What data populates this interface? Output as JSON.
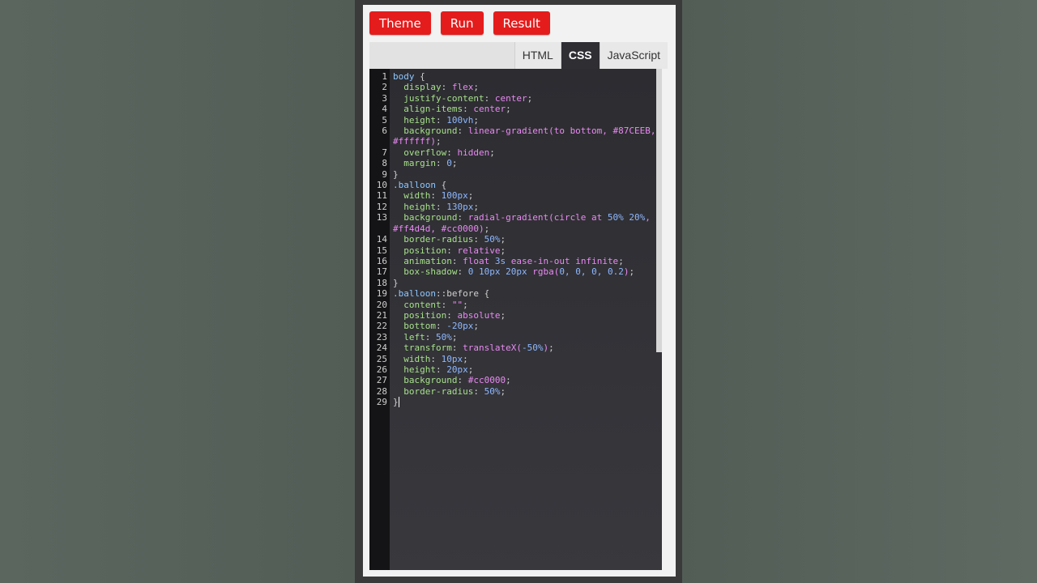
{
  "toolbar": {
    "buttons": [
      {
        "label": "Theme"
      },
      {
        "label": "Run"
      },
      {
        "label": "Result"
      }
    ],
    "color": "#e51c1c"
  },
  "tabs": [
    {
      "label": "HTML",
      "active": false
    },
    {
      "label": "CSS",
      "active": true
    },
    {
      "label": "JavaScript",
      "active": false
    }
  ],
  "editor": {
    "language": "css",
    "lines": [
      [
        [
          "sel",
          "body"
        ],
        [
          "punc",
          " {"
        ]
      ],
      [
        [
          "prop",
          "  display"
        ],
        [
          "punc",
          ": "
        ],
        [
          "kw",
          "flex"
        ],
        [
          "punc",
          ";"
        ]
      ],
      [
        [
          "prop",
          "  justify-content"
        ],
        [
          "punc",
          ": "
        ],
        [
          "kw",
          "center"
        ],
        [
          "punc",
          ";"
        ]
      ],
      [
        [
          "prop",
          "  align-items"
        ],
        [
          "punc",
          ": "
        ],
        [
          "kw",
          "center"
        ],
        [
          "punc",
          ";"
        ]
      ],
      [
        [
          "prop",
          "  height"
        ],
        [
          "punc",
          ": "
        ],
        [
          "num",
          "100vh"
        ],
        [
          "punc",
          ";"
        ]
      ],
      [
        [
          "prop",
          "  background"
        ],
        [
          "punc",
          ": "
        ],
        [
          "kw",
          "linear-gradient(to bottom, #87CEEB, #ffffff)"
        ],
        [
          "punc",
          ";"
        ]
      ],
      [
        [
          "prop",
          "  overflow"
        ],
        [
          "punc",
          ": "
        ],
        [
          "kw",
          "hidden"
        ],
        [
          "punc",
          ";"
        ]
      ],
      [
        [
          "prop",
          "  margin"
        ],
        [
          "punc",
          ": "
        ],
        [
          "num",
          "0"
        ],
        [
          "punc",
          ";"
        ]
      ],
      [
        [
          "punc",
          "}"
        ]
      ],
      [
        [
          "sel",
          ".balloon"
        ],
        [
          "punc",
          " {"
        ]
      ],
      [
        [
          "prop",
          "  width"
        ],
        [
          "punc",
          ": "
        ],
        [
          "num",
          "100px"
        ],
        [
          "punc",
          ";"
        ]
      ],
      [
        [
          "prop",
          "  height"
        ],
        [
          "punc",
          ": "
        ],
        [
          "num",
          "130px"
        ],
        [
          "punc",
          ";"
        ]
      ],
      [
        [
          "prop",
          "  background"
        ],
        [
          "punc",
          ": "
        ],
        [
          "kw",
          "radial-gradient(circle at "
        ],
        [
          "num",
          "50% 20%"
        ],
        [
          "kw",
          ", #ff4d4d, #cc0000)"
        ],
        [
          "punc",
          ";"
        ]
      ],
      [
        [
          "prop",
          "  border-radius"
        ],
        [
          "punc",
          ": "
        ],
        [
          "num",
          "50%"
        ],
        [
          "punc",
          ";"
        ]
      ],
      [
        [
          "prop",
          "  position"
        ],
        [
          "punc",
          ": "
        ],
        [
          "kw",
          "relative"
        ],
        [
          "punc",
          ";"
        ]
      ],
      [
        [
          "prop",
          "  animation"
        ],
        [
          "punc",
          ": "
        ],
        [
          "kw",
          "float "
        ],
        [
          "num",
          "3s"
        ],
        [
          "kw",
          " ease-in-out infinite"
        ],
        [
          "punc",
          ";"
        ]
      ],
      [
        [
          "prop",
          "  box-shadow"
        ],
        [
          "punc",
          ": "
        ],
        [
          "num",
          "0 10px 20px"
        ],
        [
          "kw",
          " rgba("
        ],
        [
          "num",
          "0, 0, 0, 0.2"
        ],
        [
          "kw",
          ")"
        ],
        [
          "punc",
          ";"
        ]
      ],
      [
        [
          "punc",
          "}"
        ]
      ],
      [
        [
          "sel",
          ".balloon"
        ],
        [
          "punc",
          "::before {"
        ]
      ],
      [
        [
          "prop",
          "  content"
        ],
        [
          "punc",
          ": "
        ],
        [
          "kw",
          "\"\""
        ],
        [
          "punc",
          ";"
        ]
      ],
      [
        [
          "prop",
          "  position"
        ],
        [
          "punc",
          ": "
        ],
        [
          "kw",
          "absolute"
        ],
        [
          "punc",
          ";"
        ]
      ],
      [
        [
          "prop",
          "  bottom"
        ],
        [
          "punc",
          ": "
        ],
        [
          "num",
          "-20px"
        ],
        [
          "punc",
          ";"
        ]
      ],
      [
        [
          "prop",
          "  left"
        ],
        [
          "punc",
          ": "
        ],
        [
          "num",
          "50%"
        ],
        [
          "punc",
          ";"
        ]
      ],
      [
        [
          "prop",
          "  transform"
        ],
        [
          "punc",
          ": "
        ],
        [
          "kw",
          "translateX("
        ],
        [
          "num",
          "-50%"
        ],
        [
          "kw",
          ")"
        ],
        [
          "punc",
          ";"
        ]
      ],
      [
        [
          "prop",
          "  width"
        ],
        [
          "punc",
          ": "
        ],
        [
          "num",
          "10px"
        ],
        [
          "punc",
          ";"
        ]
      ],
      [
        [
          "prop",
          "  height"
        ],
        [
          "punc",
          ": "
        ],
        [
          "num",
          "20px"
        ],
        [
          "punc",
          ";"
        ]
      ],
      [
        [
          "prop",
          "  background"
        ],
        [
          "punc",
          ": "
        ],
        [
          "kw",
          "#cc0000"
        ],
        [
          "punc",
          ";"
        ]
      ],
      [
        [
          "prop",
          "  border-radius"
        ],
        [
          "punc",
          ": "
        ],
        [
          "num",
          "50%"
        ],
        [
          "punc",
          ";"
        ]
      ],
      [
        [
          "punc",
          "}"
        ]
      ]
    ]
  }
}
